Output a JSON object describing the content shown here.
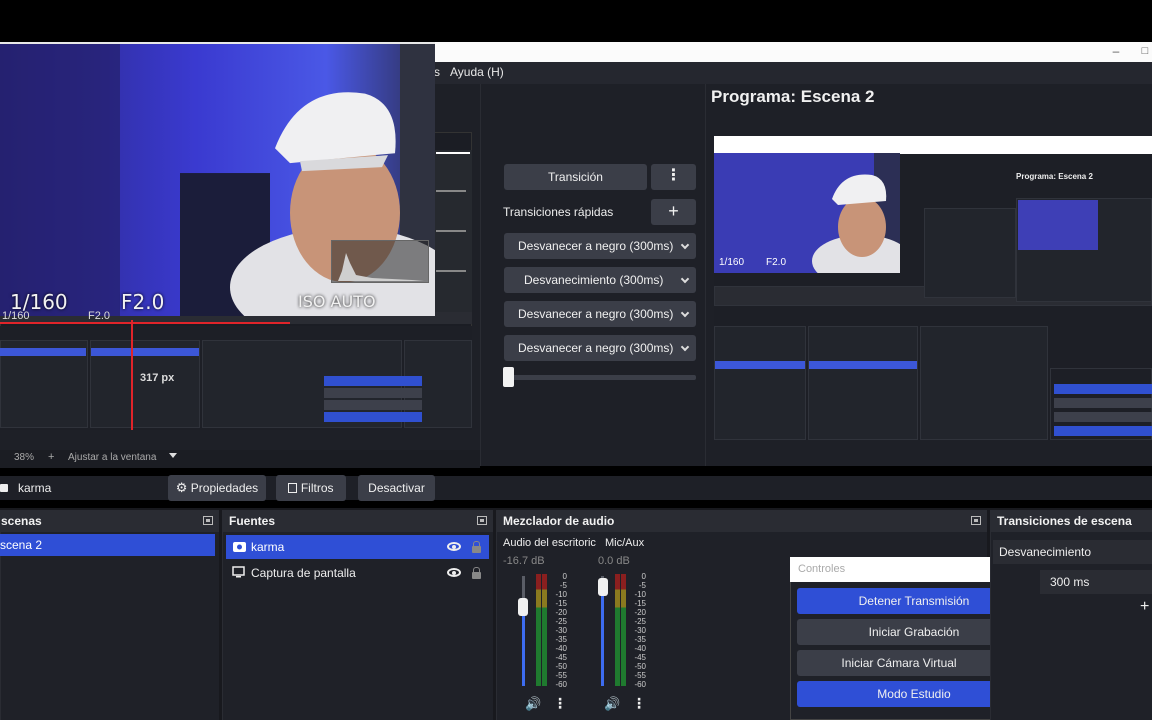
{
  "menu": {
    "partial_item": "s",
    "help": "Ayuda (H)"
  },
  "window_controls": {
    "minimize": "–",
    "maximize": "□"
  },
  "camera_overlay": {
    "shutter": "1/160",
    "aperture": "F2.0",
    "iso": "ISO AUTO"
  },
  "preview": {
    "distance_label": "317 px",
    "nested_shutter": "1/160",
    "nested_aperture": "F2.0",
    "zoom_percent": "38%",
    "zoom_plus": "+",
    "zoom_fit_label": "Ajustar a la ventana"
  },
  "transitions_center": {
    "transition_button": "Transición",
    "menu_glyph": "⋮",
    "quick_label": "Transiciones rápidas",
    "add_glyph": "+",
    "quick_items": [
      "Desvanecer a negro (300ms)",
      "Desvanecimiento (300ms)",
      "Desvanecer a negro (300ms)",
      "Desvanecer a negro (300ms)"
    ]
  },
  "program": {
    "title": "Programa: Escena 2",
    "mini_title": "Programa: Escena 2",
    "mini_shutter": "1/160",
    "mini_aperture": "F2.0"
  },
  "source_toolbar": {
    "selected_source": "karma",
    "properties": "Propiedades",
    "filters": "Filtros",
    "deactivate": "Desactivar"
  },
  "scenes_dock": {
    "title": "scenas",
    "selected": "scena 2"
  },
  "sources_dock": {
    "title": "Fuentes",
    "items": [
      "karma",
      "Captura de pantalla"
    ]
  },
  "mixer_dock": {
    "title": "Mezclador de audio",
    "channels": [
      {
        "name": "Audio del escritoric",
        "db": "-16.7 dB",
        "level": 0.72
      },
      {
        "name": "Mic/Aux",
        "db": "0.0 dB",
        "level": 0.9
      }
    ],
    "scale": [
      "0",
      "-5",
      "-10",
      "-15",
      "-20",
      "-25",
      "-30",
      "-35",
      "-40",
      "-45",
      "-50",
      "-55",
      "-60"
    ]
  },
  "controls_popup": {
    "title": "Controles",
    "stop_stream": "Detener Transmisión",
    "start_recording": "Iniciar Grabación",
    "start_vcam": "Iniciar Cámara Virtual",
    "studio_mode": "Modo Estudio"
  },
  "transitions_dock": {
    "title": "Transiciones de escena",
    "current": "Desvanecimiento",
    "duration": "300 ms",
    "add": "+"
  },
  "colors": {
    "accent": "#2f4fd6",
    "panel": "#1f2128",
    "button": "#3b3e48",
    "guide_red": "#e0242a"
  }
}
